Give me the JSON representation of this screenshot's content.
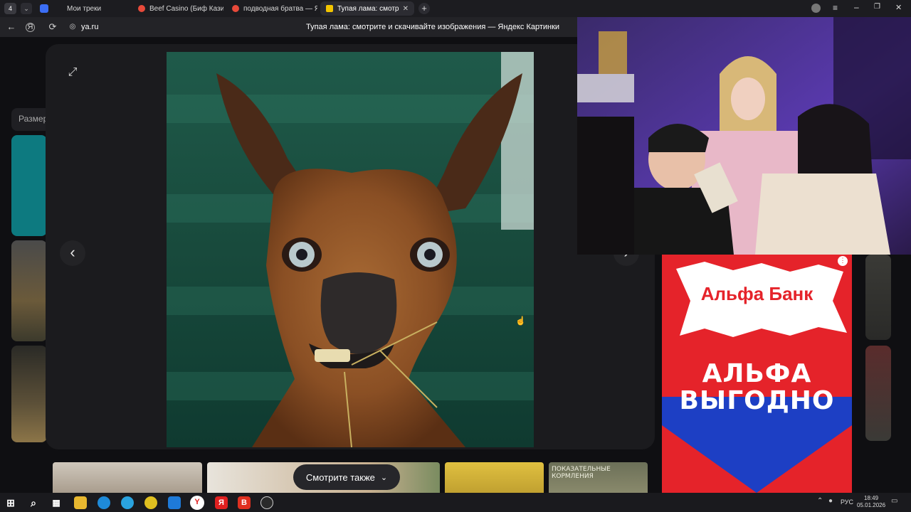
{
  "tabs": [
    {
      "label": "Мои треки",
      "color": "#3b6ef5"
    },
    {
      "label": "Beef Casino (Биф Казино)",
      "color": "#e84a3a"
    },
    {
      "label": "подводная братва — Янд",
      "color": "#e84a3a"
    },
    {
      "label": "Тупая лама: смотрите",
      "color": "#f2c400"
    }
  ],
  "address": {
    "domain": "ya.ru",
    "page_title": "Тупая лама: смотрите и скачивайте изображения — Яндекс Картинки"
  },
  "sidebar": {
    "size_label": "Размер"
  },
  "viewer": {
    "see_also_label": "Смотрите также"
  },
  "bottom_thumbs": [
    {
      "label": ""
    },
    {
      "label": ""
    },
    {
      "label": ""
    },
    {
      "label": ""
    },
    {
      "label": "ПОКАЗАТЕЛЬНЫЕ КОРМЛЕНИЯ"
    }
  ],
  "ad": {
    "brand": "Альфа Банк",
    "headline_1": "АЛЬФА",
    "headline_2": "ВЫГОДНО",
    "brand_color": "#e5232a"
  },
  "taskbar": {
    "language": "РУС",
    "time": "18:49",
    "date": "05.01.2026"
  },
  "colors": {
    "accent": "#ffcc00",
    "page_bg": "#0d0d0f"
  }
}
